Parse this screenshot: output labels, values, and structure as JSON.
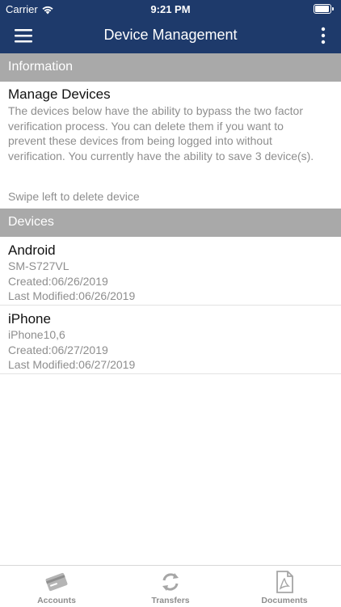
{
  "status_bar": {
    "carrier": "Carrier",
    "time": "9:21 PM"
  },
  "nav": {
    "title": "Device Management",
    "menu_icon": "hamburger-menu-icon",
    "more_icon": "more-vertical-icon"
  },
  "information": {
    "header": "Information",
    "title": "Manage Devices",
    "text": "The devices below have the ability to bypass the two factor verification process.  You can delete them if you want to prevent these devices from being logged into without verification.  You currently have the ability to save 3 device(s).",
    "hint": "Swipe left to delete device"
  },
  "devices": {
    "header": "Devices",
    "items": [
      {
        "name": "Android",
        "model": "SM-S727VL",
        "created": "Created:06/26/2019",
        "modified": "Last Modified:06/26/2019"
      },
      {
        "name": "iPhone",
        "model": "iPhone10,6",
        "created": "Created:06/27/2019",
        "modified": "Last Modified:06/27/2019"
      }
    ]
  },
  "tabs": [
    {
      "label": "Accounts",
      "icon": "credit-card-icon"
    },
    {
      "label": "Transfers",
      "icon": "transfer-arrows-icon"
    },
    {
      "label": "Documents",
      "icon": "pdf-document-icon"
    }
  ],
  "colors": {
    "nav_background": "#1e3a6b",
    "section_header": "#a9a9a9",
    "secondary_text": "#8e8e8e"
  }
}
